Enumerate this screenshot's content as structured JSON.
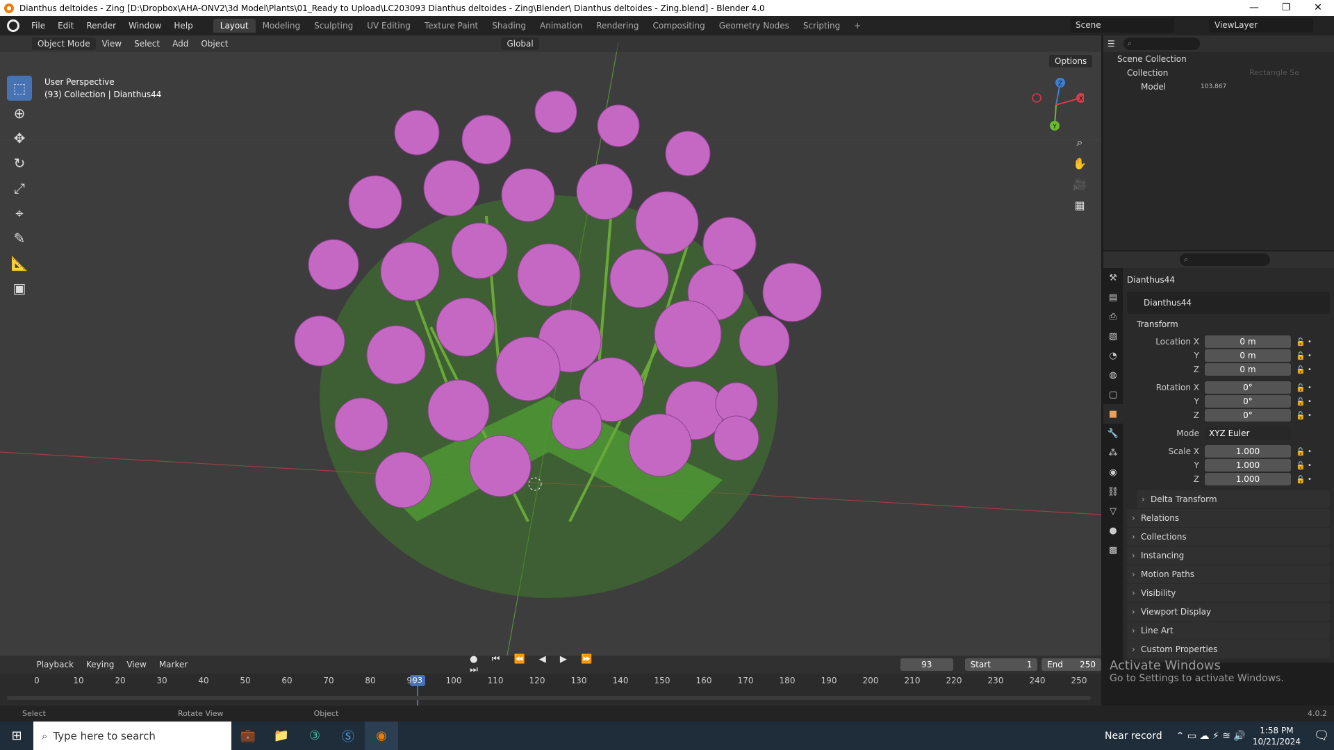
{
  "window": {
    "title": "Dianthus deltoides - Zing [D:\\Dropbox\\AHA-ONV2\\3d Model\\Plants\\01_Ready to Upload\\LC203093 Dianthus deltoides - Zing\\Blender\\ Dianthus deltoides - Zing.blend] - Blender 4.0",
    "minimize": "—",
    "maximize": "❐",
    "close": "✕"
  },
  "menu": [
    "File",
    "Edit",
    "Render",
    "Window",
    "Help"
  ],
  "workspaces": [
    "Layout",
    "Modeling",
    "Sculpting",
    "UV Editing",
    "Texture Paint",
    "Shading",
    "Animation",
    "Rendering",
    "Compositing",
    "Geometry Nodes",
    "Scripting",
    "+"
  ],
  "scene": {
    "name": "Scene",
    "view_layer": "ViewLayer"
  },
  "viewport": {
    "mode": "Object Mode",
    "menus": [
      "View",
      "Select",
      "Add",
      "Object"
    ],
    "orientation": "Global",
    "perspective": "User Perspective",
    "collection_info": "(93) Collection | Dianthus44",
    "options": "Options",
    "axes": {
      "x": "X",
      "y": "Y",
      "z": "Z"
    }
  },
  "outliner": {
    "scene_collection": "Scene Collection",
    "collection": "Collection",
    "model": "Model",
    "overlay_label": "Rectangle Se",
    "overlay_num": "103.867"
  },
  "properties": {
    "object_name": "Dianthus44",
    "data_name": "Dianthus44",
    "transform_title": "Transform",
    "location": {
      "label": "Location X",
      "x": "0 m",
      "y": "0 m",
      "z": "0 m"
    },
    "rotation": {
      "label": "Rotation X",
      "x": "0°",
      "y": "0°",
      "z": "0°"
    },
    "mode": {
      "label": "Mode",
      "value": "XYZ Euler"
    },
    "scale": {
      "label": "Scale X",
      "x": "1.000",
      "y": "1.000",
      "z": "1.000"
    },
    "y": "Y",
    "z": "Z",
    "panels": [
      "Delta Transform",
      "Relations",
      "Collections",
      "Instancing",
      "Motion Paths",
      "Visibility",
      "Viewport Display",
      "Line Art",
      "Custom Properties"
    ]
  },
  "timeline": {
    "menus": [
      "Playback",
      "Keying",
      "View",
      "Marker"
    ],
    "current": "93",
    "start_label": "Start",
    "start": "1",
    "end_label": "End",
    "end": "250",
    "ticks": [
      "0",
      "10",
      "20",
      "30",
      "40",
      "50",
      "60",
      "70",
      "80",
      "90",
      "100",
      "110",
      "120",
      "130",
      "140",
      "150",
      "160",
      "170",
      "180",
      "190",
      "200",
      "210",
      "220",
      "230",
      "240",
      "250"
    ]
  },
  "status": {
    "select": "Select",
    "rotate": "Rotate View",
    "object": "Object",
    "version": "4.0.2"
  },
  "activate": {
    "line1": "Activate Windows",
    "line2": "Go to Settings to activate Windows."
  },
  "taskbar": {
    "search": "Type here to search",
    "weather": "Near record",
    "time": "1:58 PM",
    "date": "10/21/2024"
  }
}
